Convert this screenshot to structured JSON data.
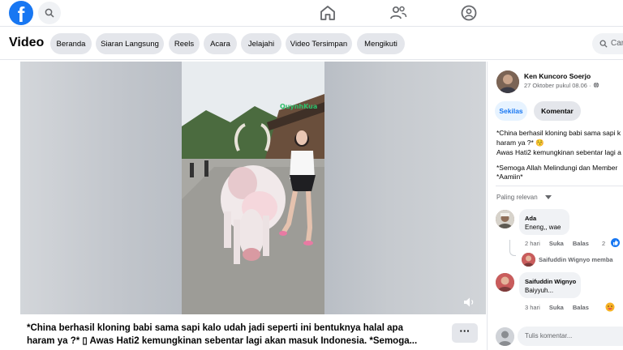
{
  "topbar": {
    "logo_letter": "f",
    "icons": [
      "home-icon",
      "friends-icon",
      "groups-icon"
    ]
  },
  "subnav": {
    "title": "Video",
    "pills": [
      "Beranda",
      "Siaran Langsung",
      "Reels",
      "Acara",
      "Jelajahi",
      "Video Tersimpan",
      "Mengikuti"
    ],
    "search_label": "Car"
  },
  "video": {
    "watermark": "QuynhKua",
    "caption_line1": "*China berhasil kloning babi sama sapi kalo udah jadi seperti ini bentuknya halal apa",
    "caption_line2": "haram ya ?* ▯ Awas Hati2 kemungkinan sebentar lagi akan masuk Indonesia. *Semoga...",
    "more_label": "···"
  },
  "post": {
    "author": "Ken Kuncoro Soerjo",
    "date": "27 Oktober pukul 08.06 ·",
    "tabs": [
      "Sekilas",
      "Komentar"
    ],
    "desc_lines": [
      "*China berhasil kloning babi sama sapi k",
      "haram ya ?* 😚",
      "Awas Hati2 kemungkinan sebentar lagi a",
      "*Semoga Allah Melindungi dan Member",
      "*Aamiin*"
    ],
    "sort_label": "Paling relevan"
  },
  "comments": [
    {
      "name": "Ada",
      "text": "Eneng,, wae",
      "time": "2 hari",
      "like": "Suka",
      "reply": "Balas",
      "reactions": "2",
      "reply_preview": "Saifuddin Wignyo memba"
    },
    {
      "name": "Saifuddin Wignyo",
      "text": "Baiyyuh...",
      "time": "3 hari",
      "like": "Suka",
      "reply": "Balas"
    }
  ],
  "comment_input": {
    "placeholder": "Tulis komentar..."
  },
  "colors": {
    "brand": "#1877f2",
    "pill_bg": "#e4e6eb",
    "muted": "#65676b"
  }
}
